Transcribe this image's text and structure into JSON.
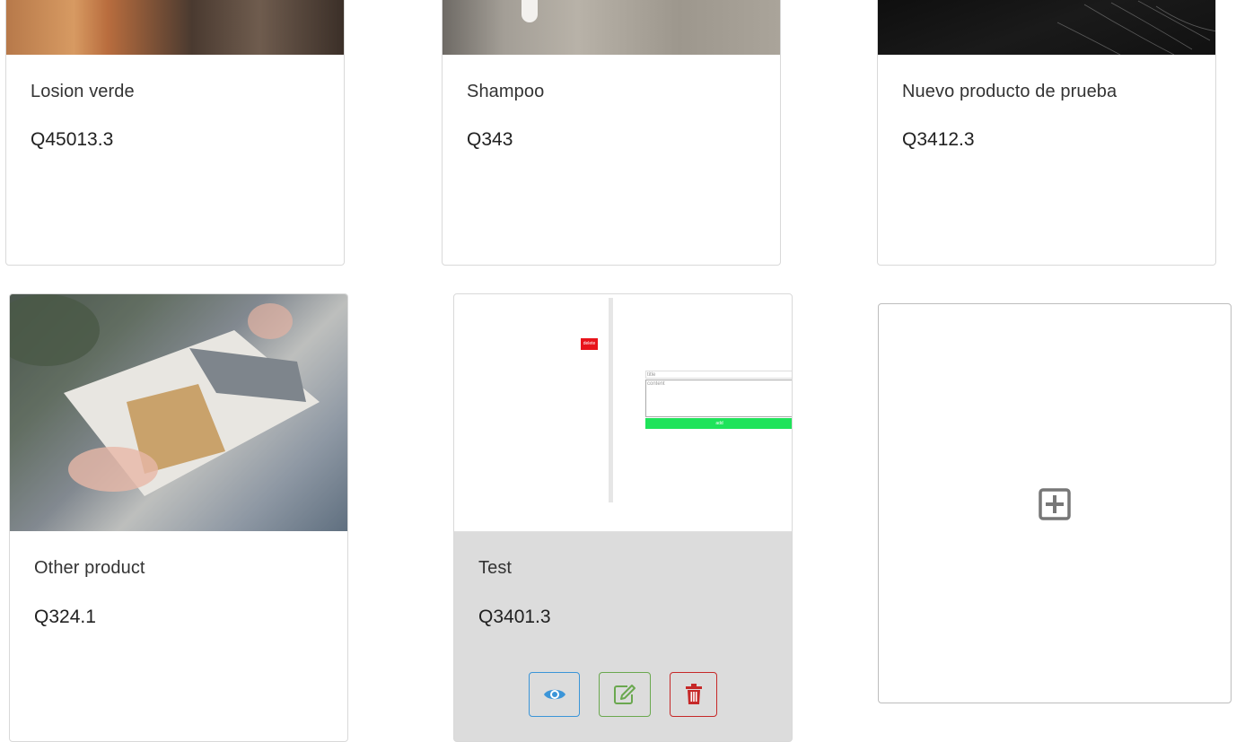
{
  "products": [
    {
      "name": "Losion verde",
      "price": "Q45013.3"
    },
    {
      "name": "Shampoo",
      "price": "Q343"
    },
    {
      "name": "Nuevo producto de prueba",
      "price": "Q3412.3"
    },
    {
      "name": "Other product",
      "price": "Q324.1"
    },
    {
      "name": "Test",
      "price": "Q3401.3"
    }
  ],
  "test_card_screenshot": {
    "delete_label": "delete",
    "title_placeholder": "title",
    "content_placeholder": "content",
    "add_label": "add"
  },
  "icons": {
    "view": "eye-icon",
    "edit": "edit-icon",
    "delete": "trash-icon",
    "add_product": "plus-square-icon"
  },
  "colors": {
    "view_accent": "#3b95d8",
    "edit_accent": "#6aa84f",
    "delete_accent": "#c62828",
    "hover_card_bg": "#dcdcdc"
  }
}
